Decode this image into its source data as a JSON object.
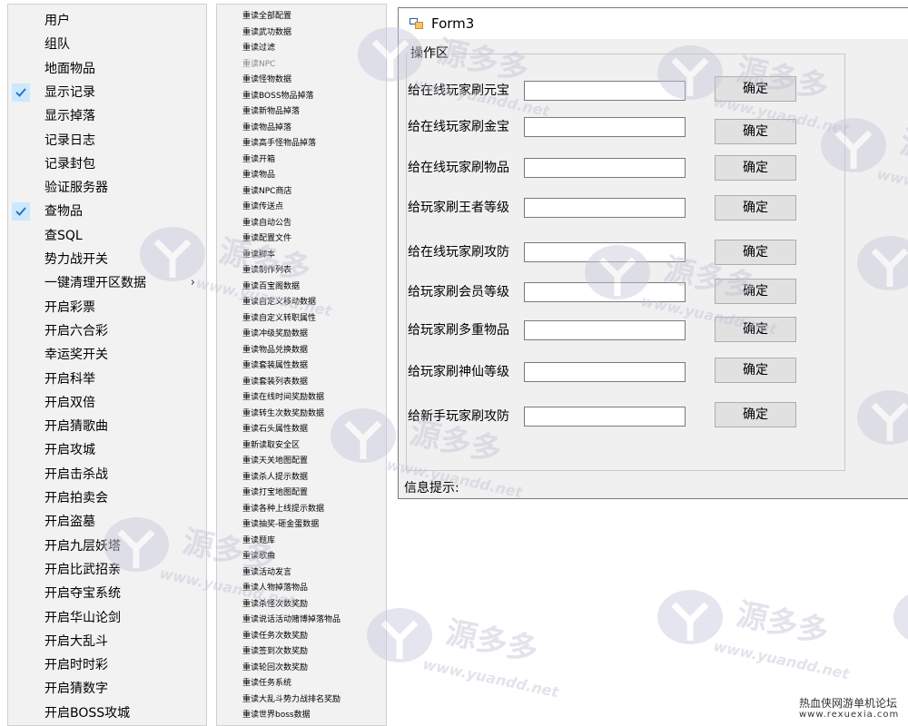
{
  "left_menu": {
    "items": [
      {
        "label": "用户",
        "checked": false,
        "submenu": false
      },
      {
        "label": "组队",
        "checked": false,
        "submenu": false
      },
      {
        "label": "地面物品",
        "checked": false,
        "submenu": false
      },
      {
        "label": "显示记录",
        "checked": true,
        "submenu": false
      },
      {
        "label": "显示掉落",
        "checked": false,
        "submenu": false
      },
      {
        "label": "记录日志",
        "checked": false,
        "submenu": false
      },
      {
        "label": "记录封包",
        "checked": false,
        "submenu": false
      },
      {
        "label": "验证服务器",
        "checked": false,
        "submenu": false
      },
      {
        "label": "查物品",
        "checked": true,
        "submenu": false
      },
      {
        "label": "查SQL",
        "checked": false,
        "submenu": false
      },
      {
        "label": "势力战开关",
        "checked": false,
        "submenu": false
      },
      {
        "label": "一键清理开区数据",
        "checked": false,
        "submenu": true
      },
      {
        "label": "开启彩票",
        "checked": false,
        "submenu": false
      },
      {
        "label": "开启六合彩",
        "checked": false,
        "submenu": false
      },
      {
        "label": "幸运奖开关",
        "checked": false,
        "submenu": false
      },
      {
        "label": "开启科举",
        "checked": false,
        "submenu": false
      },
      {
        "label": "开启双倍",
        "checked": false,
        "submenu": false
      },
      {
        "label": "开启猜歌曲",
        "checked": false,
        "submenu": false
      },
      {
        "label": "开启攻城",
        "checked": false,
        "submenu": false
      },
      {
        "label": "开启击杀战",
        "checked": false,
        "submenu": false
      },
      {
        "label": "开启拍卖会",
        "checked": false,
        "submenu": false
      },
      {
        "label": "开启盗墓",
        "checked": false,
        "submenu": false
      },
      {
        "label": "开启九层妖塔",
        "checked": false,
        "submenu": false
      },
      {
        "label": "开启比武招亲",
        "checked": false,
        "submenu": false
      },
      {
        "label": "开启夺宝系统",
        "checked": false,
        "submenu": false
      },
      {
        "label": "开启华山论剑",
        "checked": false,
        "submenu": false
      },
      {
        "label": "开启大乱斗",
        "checked": false,
        "submenu": false
      },
      {
        "label": "开启时时彩",
        "checked": false,
        "submenu": false
      },
      {
        "label": "开启猜数字",
        "checked": false,
        "submenu": false
      },
      {
        "label": "开启BOSS攻城",
        "checked": false,
        "submenu": false
      }
    ]
  },
  "mid_menu": {
    "items": [
      {
        "label": "重读全部配置",
        "disabled": false
      },
      {
        "label": "重读武功数据",
        "disabled": false
      },
      {
        "label": "重读过滤",
        "disabled": false
      },
      {
        "label": "重读NPC",
        "disabled": true
      },
      {
        "label": "重读怪物数据",
        "disabled": false
      },
      {
        "label": "重读BOSS物品掉落",
        "disabled": false
      },
      {
        "label": "重读新物品掉落",
        "disabled": false
      },
      {
        "label": "重读物品掉落",
        "disabled": false
      },
      {
        "label": "重读高手怪物品掉落",
        "disabled": false
      },
      {
        "label": "重读开箱",
        "disabled": false
      },
      {
        "label": "重读物品",
        "disabled": false
      },
      {
        "label": "重读NPC商店",
        "disabled": false
      },
      {
        "label": "重读传送点",
        "disabled": false
      },
      {
        "label": "重读自动公告",
        "disabled": false
      },
      {
        "label": "重读配置文件",
        "disabled": false
      },
      {
        "label": "重读脚本",
        "disabled": false
      },
      {
        "label": "重读制作列表",
        "disabled": false
      },
      {
        "label": "重读百宝阁数据",
        "disabled": false
      },
      {
        "label": "重读自定义移动数据",
        "disabled": false
      },
      {
        "label": "重读自定义转职属性",
        "disabled": false
      },
      {
        "label": "重读冲级奖励数据",
        "disabled": false
      },
      {
        "label": "重读物品兑换数据",
        "disabled": false
      },
      {
        "label": "重读套装属性数据",
        "disabled": false
      },
      {
        "label": "重读套装列表数据",
        "disabled": false
      },
      {
        "label": "重读在线时间奖励数据",
        "disabled": false
      },
      {
        "label": "重读转生次数奖励数据",
        "disabled": false
      },
      {
        "label": "重读石头属性数据",
        "disabled": false
      },
      {
        "label": "重新读取安全区",
        "disabled": false
      },
      {
        "label": "重读天关地图配置",
        "disabled": false
      },
      {
        "label": "重读杀人提示数据",
        "disabled": false
      },
      {
        "label": "重读打宝地图配置",
        "disabled": false
      },
      {
        "label": "重读各种上线提示数据",
        "disabled": false
      },
      {
        "label": "重读抽奖-砸金蛋数据",
        "disabled": false
      },
      {
        "label": "重读题库",
        "disabled": false
      },
      {
        "label": "重读歌曲",
        "disabled": false
      },
      {
        "label": "重读活动发言",
        "disabled": false
      },
      {
        "label": "重读人物掉落物品",
        "disabled": false
      },
      {
        "label": "重读杀怪次数奖励",
        "disabled": false
      },
      {
        "label": "重读说话活动赌博掉落物品",
        "disabled": false
      },
      {
        "label": "重读任务次数奖励",
        "disabled": false
      },
      {
        "label": "重读签到次数奖励",
        "disabled": false
      },
      {
        "label": "重读轮回次数奖励",
        "disabled": false
      },
      {
        "label": "重读任务系统",
        "disabled": false
      },
      {
        "label": "重读大乱斗势力战排名奖励",
        "disabled": false
      },
      {
        "label": "重读世界boss数据",
        "disabled": false
      }
    ]
  },
  "form": {
    "title": "Form3",
    "group_label": "操作区",
    "rows": [
      {
        "label": "给在线玩家刷元宝",
        "value": "",
        "button": "确定"
      },
      {
        "label": "给在线玩家刷金宝",
        "value": "",
        "button": "确定"
      },
      {
        "label": "给在线玩家刷物品",
        "value": "",
        "button": "确定"
      },
      {
        "label": "给玩家刷王者等级",
        "value": "",
        "button": "确定"
      },
      {
        "label": "给在线玩家刷攻防",
        "value": "",
        "button": "确定"
      },
      {
        "label": "给玩家刷会员等级",
        "value": "",
        "button": "确定"
      },
      {
        "label": "给玩家刷多重物品",
        "value": "",
        "button": "确定"
      },
      {
        "label": "给玩家刷神仙等级",
        "value": "",
        "button": "确定"
      },
      {
        "label": "给新手玩家刷攻防",
        "value": "",
        "button": "确定"
      }
    ],
    "info_label": "信息提示:"
  },
  "watermark": {
    "brand": "源多多",
    "url": "www.yuandd.net",
    "footer_site": "热血侠网游单机论坛",
    "footer_url": "www.rexuexia.com"
  },
  "colors": {
    "check_bg": "#cce8ff",
    "check_mark": "#1f6fbf",
    "watermark": "#d9d9e6"
  }
}
